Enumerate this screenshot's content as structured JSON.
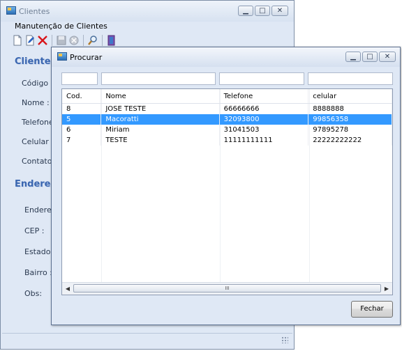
{
  "back_window": {
    "title": "Clientes",
    "menu": "Manutenção de Clientes",
    "toolbar": [
      "new-icon",
      "edit-icon",
      "delete-icon",
      "save-icon",
      "cancel-icon",
      "search-icon",
      "exit-icon"
    ],
    "section_cliente": "Cliente",
    "section_endereco": "Endereço",
    "labels": {
      "codigo": "Código :",
      "nome": "Nome :",
      "telefone": "Telefone :",
      "celular": "Celular :",
      "contato": "Contato :",
      "endereco": "Endereço",
      "cep": "CEP :",
      "estado": "Estado :",
      "bairro": "Bairro :",
      "obs": "Obs:"
    }
  },
  "dialog": {
    "title": "Procurar",
    "columns": [
      "Cod.",
      "Nome",
      "Telefone",
      "celular"
    ],
    "rows": [
      {
        "cod": "8",
        "nome": "JOSE TESTE",
        "telefone": "66666666",
        "celular": "8888888"
      },
      {
        "cod": "5",
        "nome": "Macoratti",
        "telefone": "32093800",
        "celular": "99856358",
        "selected": true
      },
      {
        "cod": "6",
        "nome": "Miriam",
        "telefone": "31041503",
        "celular": "97895278"
      },
      {
        "cod": "7",
        "nome": "TESTE",
        "telefone": "11111111111",
        "celular": "22222222222"
      }
    ],
    "scroll_thumb": "III",
    "close_button": "Fechar"
  },
  "colors": {
    "selection": "#3399ff",
    "window_bg": "#dfe8f5",
    "section_title": "#3a66b0"
  }
}
